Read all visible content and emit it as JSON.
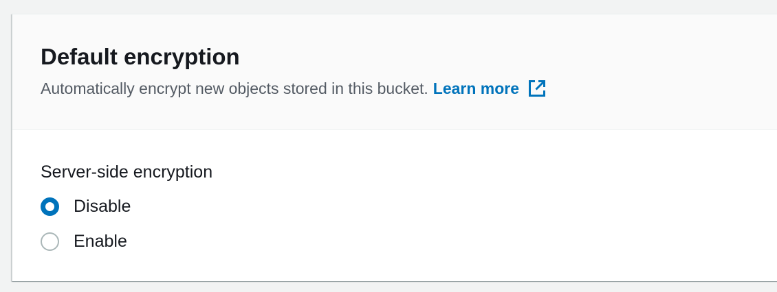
{
  "panel": {
    "title": "Default encryption",
    "description": "Automatically encrypt new objects stored in this bucket.",
    "learn_more_label": "Learn more",
    "learn_more_icon": "external-link-icon"
  },
  "encryption": {
    "group_label": "Server-side encryption",
    "options": [
      {
        "label": "Disable",
        "selected": true
      },
      {
        "label": "Enable",
        "selected": false
      }
    ]
  },
  "colors": {
    "link": "#0073bb",
    "radio_selected": "#0073bb",
    "radio_unselected": "#aab7b8",
    "page_background": "#f2f3f3",
    "header_background": "#fafafa"
  }
}
